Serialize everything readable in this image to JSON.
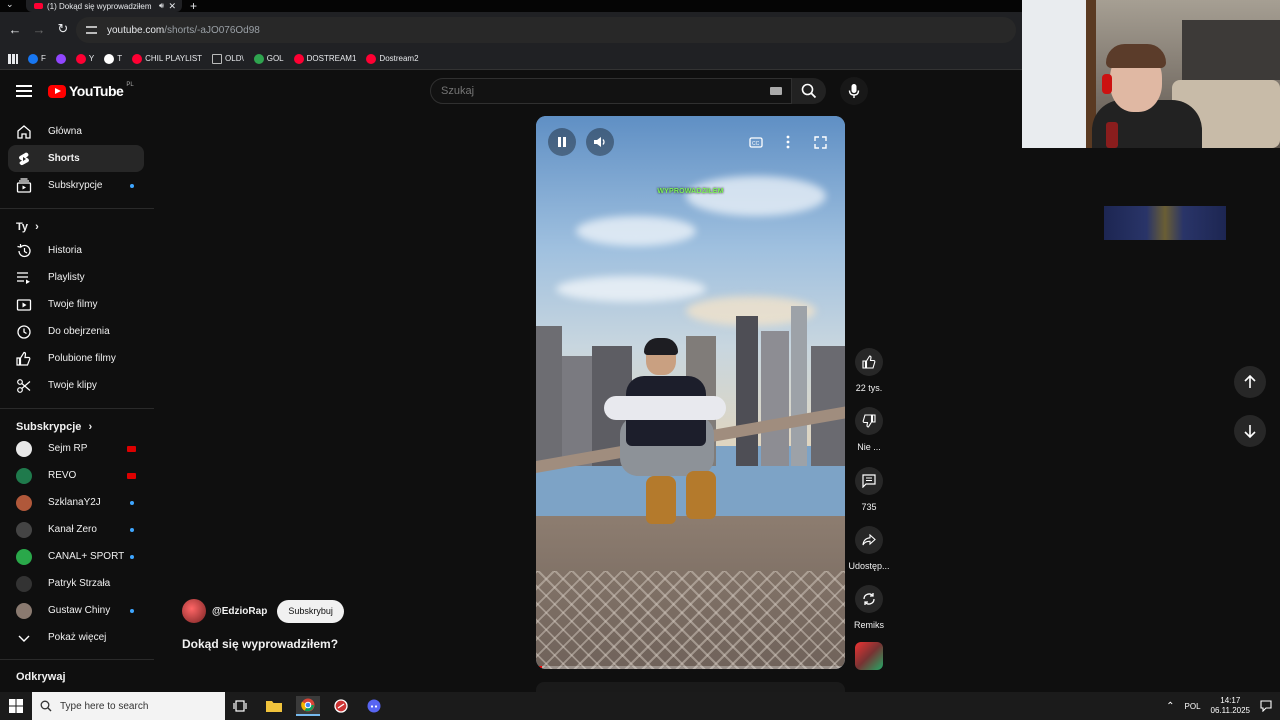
{
  "browser": {
    "tab_title": "(1) Dokąd się wyprowadziłem",
    "url_host": "youtube.com",
    "url_path": "/shorts/-aJO076Od98",
    "bookmarks": [
      {
        "label": "F",
        "icon": "facebook-icon",
        "color": "#1877f2"
      },
      {
        "label": "",
        "icon": "twitch-icon",
        "color": "#9146ff"
      },
      {
        "label": "Y",
        "icon": "youtube-icon",
        "color": "#ff0033"
      },
      {
        "label": "T",
        "icon": "x-icon",
        "color": "#ffffff"
      },
      {
        "label": "CHIL PLAYLIST",
        "icon": "youtube-icon",
        "color": "#ff0033"
      },
      {
        "label": "OLD\\",
        "icon": "folder-icon",
        "color": "#bbbbbb"
      },
      {
        "label": "GOL",
        "icon": "gol-icon",
        "color": "#2fa44f"
      },
      {
        "label": "DOSTREAM1",
        "icon": "youtube-icon",
        "color": "#ff0033"
      },
      {
        "label": "Dostream2",
        "icon": "youtube-icon",
        "color": "#ff0033"
      }
    ]
  },
  "youtube": {
    "logo_text": "YouTube",
    "country": "PL",
    "search_placeholder": "Szukaj"
  },
  "sidebar": {
    "main_items": [
      {
        "label": "Główna",
        "icon": "home-icon",
        "active": false
      },
      {
        "label": "Shorts",
        "icon": "shorts-icon",
        "active": true
      },
      {
        "label": "Subskrypcje",
        "icon": "subscriptions-icon",
        "active": false,
        "dot": true
      }
    ],
    "you_heading": "Ty",
    "you_items": [
      {
        "label": "Historia",
        "icon": "history-icon"
      },
      {
        "label": "Playlisty",
        "icon": "playlists-icon"
      },
      {
        "label": "Twoje filmy",
        "icon": "your-videos-icon"
      },
      {
        "label": "Do obejrzenia",
        "icon": "watch-later-icon"
      },
      {
        "label": "Polubione filmy",
        "icon": "liked-icon"
      },
      {
        "label": "Twoje klipy",
        "icon": "clips-icon"
      }
    ],
    "subs_heading": "Subskrypcje",
    "subs": [
      {
        "label": "Sejm RP",
        "status": "live",
        "color": "#e8e8e8"
      },
      {
        "label": "REVO",
        "status": "live",
        "color": "#1f7a4c"
      },
      {
        "label": "SzklanaY2J",
        "status": "dot",
        "color": "#b0583a"
      },
      {
        "label": "Kanał Zero",
        "status": "dot",
        "color": "#444444"
      },
      {
        "label": "CANAL+ SPORT",
        "status": "dot",
        "color": "#2aa84a"
      },
      {
        "label": "Patryk Strzała",
        "status": "none",
        "color": "#333333"
      },
      {
        "label": "Gustaw Chiny",
        "status": "dot",
        "color": "#8a7a70"
      }
    ],
    "show_more": "Pokaż więcej",
    "explore_heading": "Odkrywaj"
  },
  "short": {
    "caption": "WYPROWADZIŁEM",
    "progress": 0.02,
    "channel_handle": "@EdzioRap",
    "subscribe_label": "Subskrybuj",
    "title": "Dokąd się wyprowadziłem?"
  },
  "actions": {
    "likes": "22 tys.",
    "dislike": "Nie ...",
    "comments": "735",
    "share": "Udostęp...",
    "remix": "Remiks"
  },
  "taskbar": {
    "search_placeholder": "Type here to search",
    "language": "POL",
    "time": "14:17",
    "date": "06.11.2025"
  }
}
